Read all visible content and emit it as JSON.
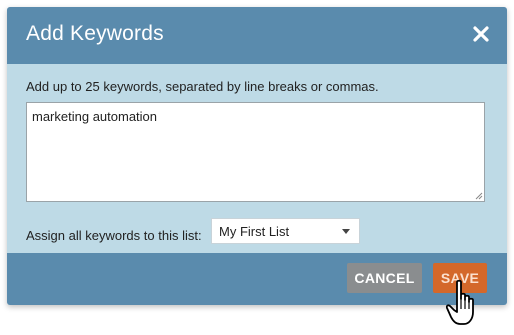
{
  "dialog": {
    "title": "Add Keywords",
    "close_icon": "close-icon"
  },
  "body": {
    "instructions": "Add up to 25 keywords, separated by line breaks or commas.",
    "keywords_value": "marketing automation",
    "assign_label": "Assign all keywords to this list:",
    "list_select": {
      "selected": "My First List"
    }
  },
  "footer": {
    "cancel_label": "CANCEL",
    "save_label": "SAVE"
  },
  "colors": {
    "header": "#5a8bad",
    "body": "#bedae6",
    "cancel": "#8a8d8f",
    "save": "#d4682a"
  },
  "icons": {
    "close": "close-icon",
    "dropdown": "chevron-down-icon",
    "cursor": "hand-pointer-icon"
  }
}
